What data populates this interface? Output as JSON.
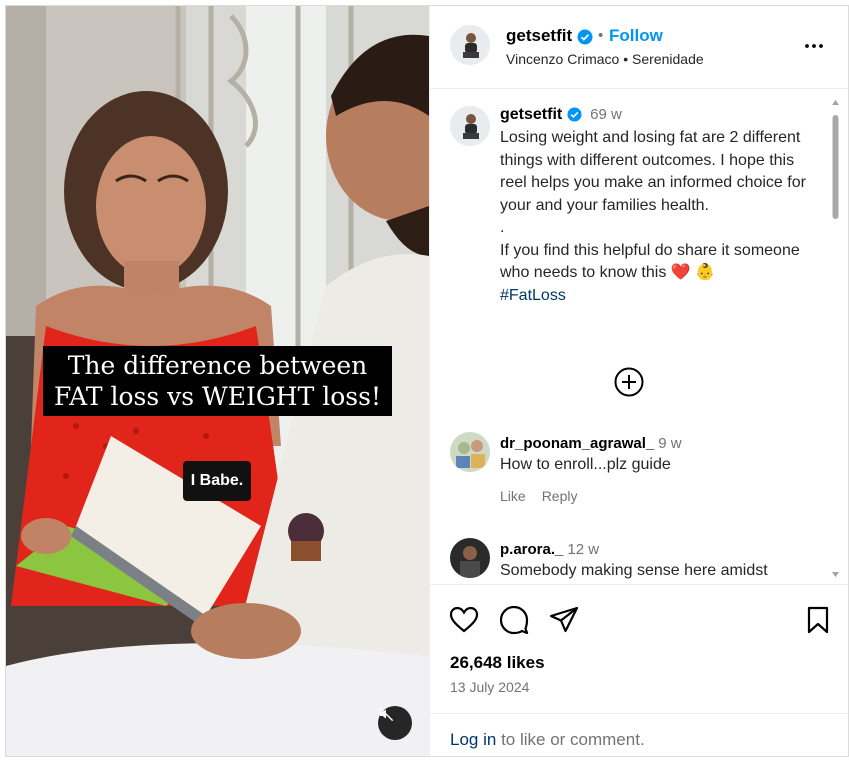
{
  "video": {
    "overlay_caption": "The difference between FAT loss vs WEIGHT loss!",
    "subtitle": "I Babe.",
    "mute_icon": "speaker-muted-icon"
  },
  "header": {
    "username": "getsetfit",
    "dot": "•",
    "follow_label": "Follow",
    "audio_credit": "Vincenzo Crimaco • Serenidade",
    "more_icon": "more-horizontal-icon"
  },
  "caption": {
    "username": "getsetfit",
    "time": "69 w",
    "text": "Losing weight and losing fat are 2 different things with different outcomes. I hope this reel helps you make an informed choice for your and your families health.\n.\nIf you find this helpful do share it someone who needs to know this ❤️ 👶",
    "hashtag": "#FatLoss"
  },
  "load_more_icon": "plus-circle-icon",
  "comments": [
    {
      "username": "dr_poonam_agrawal_",
      "time": "9 w",
      "text": "How to enroll...plz guide",
      "like_label": "Like",
      "reply_label": "Reply"
    },
    {
      "username": "p.arora._",
      "time": "12 w",
      "text": "Somebody making sense here amidst"
    }
  ],
  "actions": {
    "like_icon": "heart-icon",
    "comment_icon": "comment-icon",
    "share_icon": "send-icon",
    "save_icon": "bookmark-icon"
  },
  "likes": "26,648 likes",
  "date": "13 July 2024",
  "login": {
    "link_label": "Log in",
    "rest": "to like or comment."
  },
  "colors": {
    "accent": "#0095f6",
    "verified": "#0095f6",
    "muted_text": "#737373",
    "link": "#00376b"
  }
}
